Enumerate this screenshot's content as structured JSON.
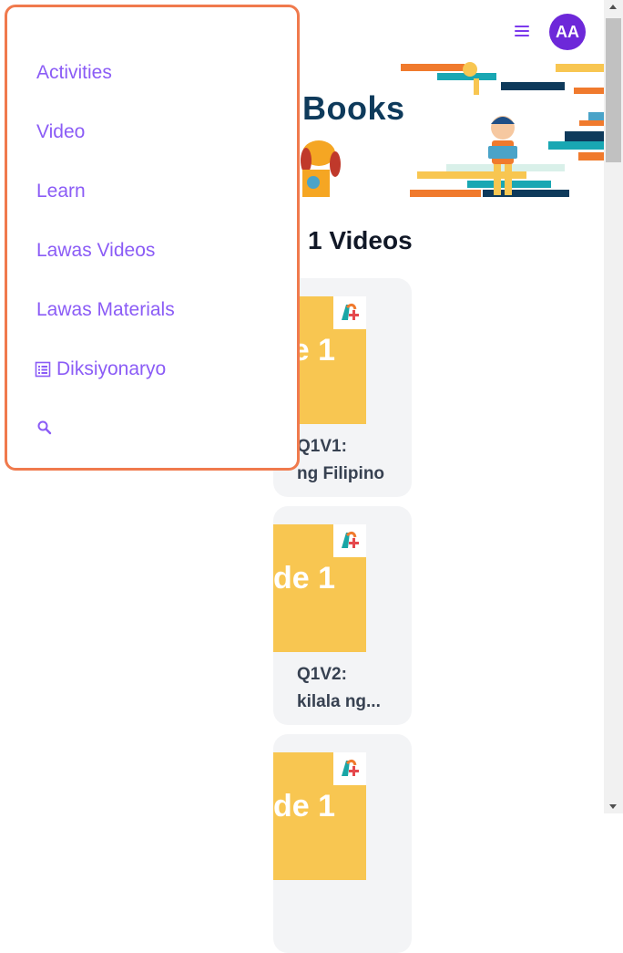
{
  "header": {
    "menu_icon": "hamburger-menu-icon",
    "avatar_initials": "AA"
  },
  "banner": {
    "title": "Books"
  },
  "section": {
    "heading": "1 Videos"
  },
  "videos": [
    {
      "thumb_text": "de 1",
      "title_line1": "Q1V1:",
      "title_line2": "ng Filipino"
    },
    {
      "thumb_text": "de 1",
      "title_line1": "Q1V2:",
      "title_line2": "kilala ng..."
    },
    {
      "thumb_text": "de 1"
    }
  ],
  "nav": {
    "items": [
      {
        "label": "Activities"
      },
      {
        "label": "Video"
      },
      {
        "label": "Learn"
      },
      {
        "label": "Lawas Videos"
      },
      {
        "label": "Lawas Materials"
      },
      {
        "label": "Diksiyonaryo",
        "icon": "dictionary-icon"
      }
    ],
    "search_icon": "search-icon"
  },
  "colors": {
    "accent": "#8b5cf6",
    "avatar_bg": "#6d28d9",
    "panel_border": "#f07a4d",
    "thumb_bg": "#f8c651",
    "card_bg": "#f3f4f6"
  }
}
